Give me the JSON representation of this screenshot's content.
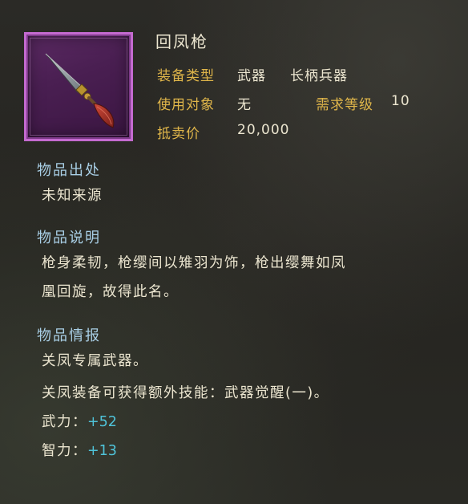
{
  "item": {
    "name": "回凤枪",
    "icon": "spear-icon",
    "rarity_color": "#c46ad0"
  },
  "attributes": {
    "equip_type_label": "装备类型",
    "equip_type_value_1": "武器",
    "equip_type_value_2": "长柄兵器",
    "user_label": "使用对象",
    "user_value": "无",
    "level_label": "需求等级",
    "level_value": "10",
    "sell_label": "抵卖价",
    "sell_value": "20,000"
  },
  "sections": {
    "origin_title": "物品出处",
    "origin_text": "未知来源",
    "description_title": "物品说明",
    "description_line_1": "枪身柔韧，枪缨间以雉羽为饰，枪出缨舞如凤",
    "description_line_2": "凰回旋，故得此名。",
    "info_title": "物品情报",
    "info_line_1": "关凤专属武器。",
    "info_line_2": "关凤装备可获得额外技能：武器觉醒(一)。"
  },
  "stats": [
    {
      "label": "武力：",
      "value": "+52"
    },
    {
      "label": "智力：",
      "value": "+13"
    }
  ],
  "colors": {
    "attribute_label": "#e0b64a",
    "section_title": "#a9cfe6",
    "stat_value": "#4fc3d9",
    "text": "#ece6d0"
  }
}
